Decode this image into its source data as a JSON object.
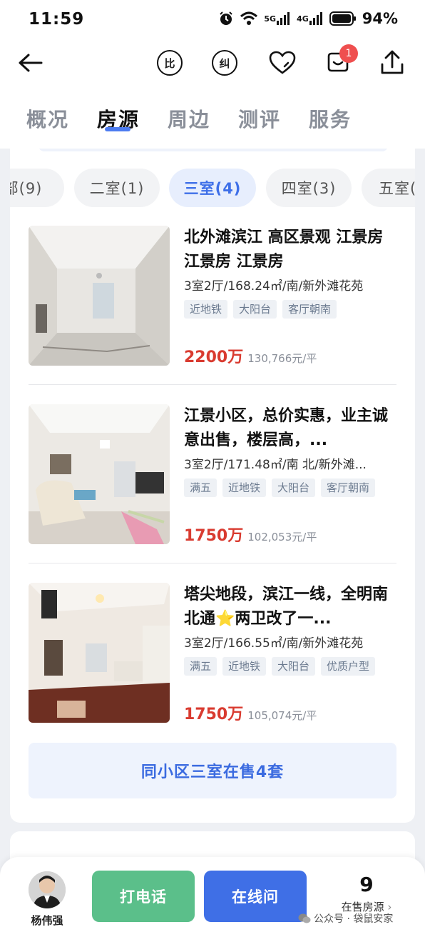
{
  "status_bar": {
    "time": "11:59",
    "network1": "5G",
    "network2": "4G",
    "battery": "94%"
  },
  "nav": {
    "compare_label": "比",
    "correct_label": "纠",
    "notification_count": "1"
  },
  "tabs": [
    {
      "label": "概况"
    },
    {
      "label": "房源"
    },
    {
      "label": "周边"
    },
    {
      "label": "测评"
    },
    {
      "label": "服务"
    }
  ],
  "filters": [
    {
      "label": "部(9)"
    },
    {
      "label": "二室(1)"
    },
    {
      "label": "三室(4)"
    },
    {
      "label": "四室(3)"
    },
    {
      "label": "五室("
    }
  ],
  "listings": [
    {
      "title": "北外滩滨江 高区景观 江景房 江景房 江景房",
      "specs": "3室2厅/168.24㎡/南/新外滩花苑",
      "tags": [
        "近地铁",
        "大阳台",
        "客厅朝南"
      ],
      "price": "2200万",
      "unit_price": "130,766元/平"
    },
    {
      "title": "江景小区，总价实惠，业主诚意出售，楼层高，...",
      "specs": "3室2厅/171.48㎡/南 北/新外滩...",
      "tags": [
        "满五",
        "近地铁",
        "大阳台",
        "客厅朝南"
      ],
      "price": "1750万",
      "unit_price": "102,053元/平"
    },
    {
      "title": "塔尖地段，滨江一线，全明南北通⭐两卫改了一...",
      "specs": "3室2厅/166.55㎡/南/新外滩花苑",
      "tags": [
        "满五",
        "近地铁",
        "大阳台",
        "优质户型"
      ],
      "price": "1750万",
      "unit_price": "105,074元/平"
    }
  ],
  "more_button": "同小区三室在售4套",
  "bottom": {
    "agent_name": "杨伟强",
    "call_label": "打电话",
    "chat_label": "在线问",
    "for_sale_count": "9",
    "for_sale_label": "在售房源",
    "watermark": "公众号 · 袋鼠安家"
  },
  "colors": {
    "accent": "#3f6fe6",
    "price": "#d93b30",
    "call": "#5bbf8a"
  }
}
